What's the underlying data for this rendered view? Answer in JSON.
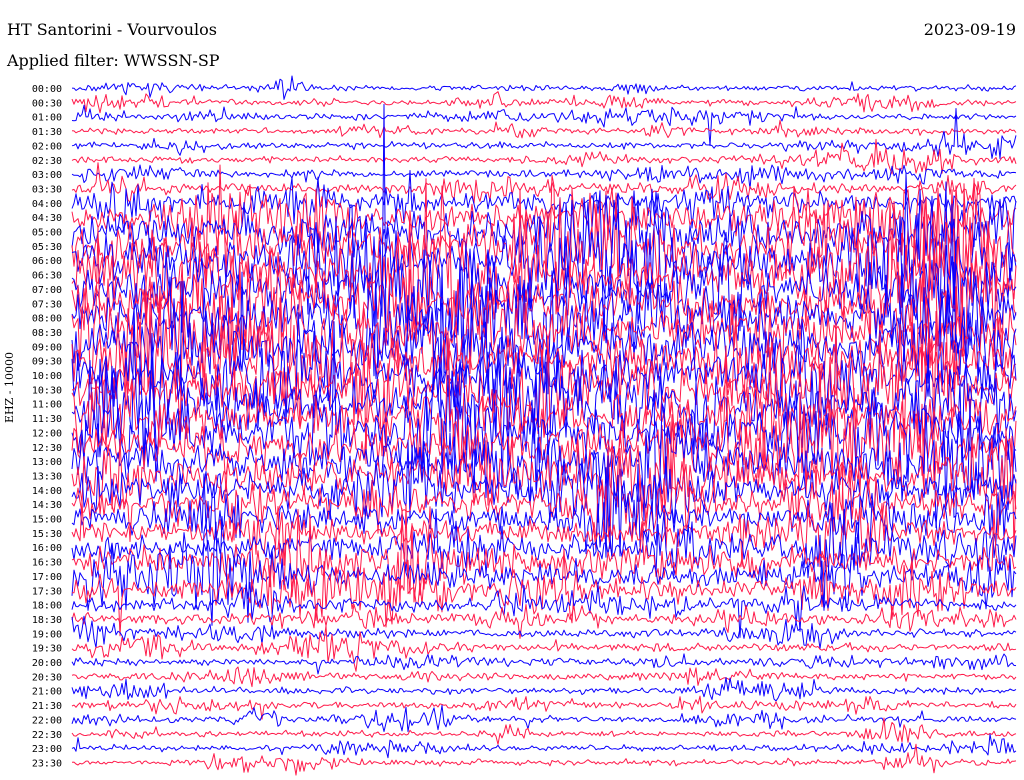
{
  "header": {
    "station": "HT Santorini - Vourvoulos",
    "date": "2023-09-19",
    "filter": "Applied filter: WWSSN-SP"
  },
  "channel_label": "EHZ - 10000",
  "colors": {
    "trace_a": "#0a00ff",
    "trace_b": "#ff1a4a",
    "background": "#ffffff"
  },
  "chart_data": {
    "type": "helicorder",
    "rows": [
      "00:00",
      "00:30",
      "01:00",
      "01:30",
      "02:00",
      "02:30",
      "03:00",
      "03:30",
      "04:00",
      "04:30",
      "05:00",
      "05:30",
      "06:00",
      "06:30",
      "07:00",
      "07:30",
      "08:00",
      "08:30",
      "09:00",
      "09:30",
      "10:00",
      "10:30",
      "11:00",
      "11:30",
      "12:00",
      "12:30",
      "13:00",
      "13:30",
      "14:00",
      "14:30",
      "15:00",
      "15:30",
      "16:00",
      "16:30",
      "17:00",
      "17:30",
      "18:00",
      "18:30",
      "19:00",
      "19:30",
      "20:00",
      "20:30",
      "21:00",
      "21:30",
      "22:00",
      "22:30",
      "23:00",
      "23:30"
    ],
    "series": [
      {
        "values": [
          0.05,
          0.06,
          0.06,
          0.06,
          0.07,
          0.07,
          0.08,
          0.15,
          0.35,
          0.6,
          0.9,
          1.0,
          1.0,
          1.0,
          1.0,
          1.0,
          1.0,
          1.0,
          1.0,
          1.0,
          1.0,
          1.0,
          1.0,
          1.0,
          1.0,
          1.0,
          0.95,
          0.85,
          0.75,
          0.65,
          0.55,
          0.45,
          0.5,
          0.6,
          0.55,
          0.45,
          0.25,
          0.18,
          0.12,
          0.1,
          0.08,
          0.08,
          0.07,
          0.07,
          0.07,
          0.06,
          0.06,
          0.06
        ]
      }
    ]
  }
}
